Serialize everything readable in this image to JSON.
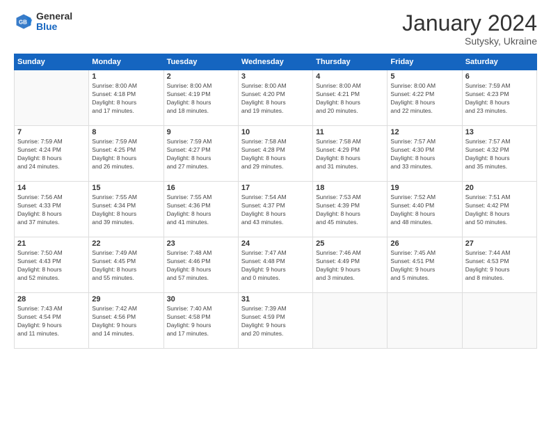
{
  "header": {
    "logo_general": "General",
    "logo_blue": "Blue",
    "month_title": "January 2024",
    "subtitle": "Sutysky, Ukraine"
  },
  "weekdays": [
    "Sunday",
    "Monday",
    "Tuesday",
    "Wednesday",
    "Thursday",
    "Friday",
    "Saturday"
  ],
  "weeks": [
    [
      {
        "day": "",
        "sunrise": "",
        "sunset": "",
        "daylight": ""
      },
      {
        "day": "1",
        "sunrise": "Sunrise: 8:00 AM",
        "sunset": "Sunset: 4:18 PM",
        "daylight": "Daylight: 8 hours and 17 minutes."
      },
      {
        "day": "2",
        "sunrise": "Sunrise: 8:00 AM",
        "sunset": "Sunset: 4:19 PM",
        "daylight": "Daylight: 8 hours and 18 minutes."
      },
      {
        "day": "3",
        "sunrise": "Sunrise: 8:00 AM",
        "sunset": "Sunset: 4:20 PM",
        "daylight": "Daylight: 8 hours and 19 minutes."
      },
      {
        "day": "4",
        "sunrise": "Sunrise: 8:00 AM",
        "sunset": "Sunset: 4:21 PM",
        "daylight": "Daylight: 8 hours and 20 minutes."
      },
      {
        "day": "5",
        "sunrise": "Sunrise: 8:00 AM",
        "sunset": "Sunset: 4:22 PM",
        "daylight": "Daylight: 8 hours and 22 minutes."
      },
      {
        "day": "6",
        "sunrise": "Sunrise: 7:59 AM",
        "sunset": "Sunset: 4:23 PM",
        "daylight": "Daylight: 8 hours and 23 minutes."
      }
    ],
    [
      {
        "day": "7",
        "sunrise": "Sunrise: 7:59 AM",
        "sunset": "Sunset: 4:24 PM",
        "daylight": "Daylight: 8 hours and 24 minutes."
      },
      {
        "day": "8",
        "sunrise": "Sunrise: 7:59 AM",
        "sunset": "Sunset: 4:25 PM",
        "daylight": "Daylight: 8 hours and 26 minutes."
      },
      {
        "day": "9",
        "sunrise": "Sunrise: 7:59 AM",
        "sunset": "Sunset: 4:27 PM",
        "daylight": "Daylight: 8 hours and 27 minutes."
      },
      {
        "day": "10",
        "sunrise": "Sunrise: 7:58 AM",
        "sunset": "Sunset: 4:28 PM",
        "daylight": "Daylight: 8 hours and 29 minutes."
      },
      {
        "day": "11",
        "sunrise": "Sunrise: 7:58 AM",
        "sunset": "Sunset: 4:29 PM",
        "daylight": "Daylight: 8 hours and 31 minutes."
      },
      {
        "day": "12",
        "sunrise": "Sunrise: 7:57 AM",
        "sunset": "Sunset: 4:30 PM",
        "daylight": "Daylight: 8 hours and 33 minutes."
      },
      {
        "day": "13",
        "sunrise": "Sunrise: 7:57 AM",
        "sunset": "Sunset: 4:32 PM",
        "daylight": "Daylight: 8 hours and 35 minutes."
      }
    ],
    [
      {
        "day": "14",
        "sunrise": "Sunrise: 7:56 AM",
        "sunset": "Sunset: 4:33 PM",
        "daylight": "Daylight: 8 hours and 37 minutes."
      },
      {
        "day": "15",
        "sunrise": "Sunrise: 7:55 AM",
        "sunset": "Sunset: 4:34 PM",
        "daylight": "Daylight: 8 hours and 39 minutes."
      },
      {
        "day": "16",
        "sunrise": "Sunrise: 7:55 AM",
        "sunset": "Sunset: 4:36 PM",
        "daylight": "Daylight: 8 hours and 41 minutes."
      },
      {
        "day": "17",
        "sunrise": "Sunrise: 7:54 AM",
        "sunset": "Sunset: 4:37 PM",
        "daylight": "Daylight: 8 hours and 43 minutes."
      },
      {
        "day": "18",
        "sunrise": "Sunrise: 7:53 AM",
        "sunset": "Sunset: 4:39 PM",
        "daylight": "Daylight: 8 hours and 45 minutes."
      },
      {
        "day": "19",
        "sunrise": "Sunrise: 7:52 AM",
        "sunset": "Sunset: 4:40 PM",
        "daylight": "Daylight: 8 hours and 48 minutes."
      },
      {
        "day": "20",
        "sunrise": "Sunrise: 7:51 AM",
        "sunset": "Sunset: 4:42 PM",
        "daylight": "Daylight: 8 hours and 50 minutes."
      }
    ],
    [
      {
        "day": "21",
        "sunrise": "Sunrise: 7:50 AM",
        "sunset": "Sunset: 4:43 PM",
        "daylight": "Daylight: 8 hours and 52 minutes."
      },
      {
        "day": "22",
        "sunrise": "Sunrise: 7:49 AM",
        "sunset": "Sunset: 4:45 PM",
        "daylight": "Daylight: 8 hours and 55 minutes."
      },
      {
        "day": "23",
        "sunrise": "Sunrise: 7:48 AM",
        "sunset": "Sunset: 4:46 PM",
        "daylight": "Daylight: 8 hours and 57 minutes."
      },
      {
        "day": "24",
        "sunrise": "Sunrise: 7:47 AM",
        "sunset": "Sunset: 4:48 PM",
        "daylight": "Daylight: 9 hours and 0 minutes."
      },
      {
        "day": "25",
        "sunrise": "Sunrise: 7:46 AM",
        "sunset": "Sunset: 4:49 PM",
        "daylight": "Daylight: 9 hours and 3 minutes."
      },
      {
        "day": "26",
        "sunrise": "Sunrise: 7:45 AM",
        "sunset": "Sunset: 4:51 PM",
        "daylight": "Daylight: 9 hours and 5 minutes."
      },
      {
        "day": "27",
        "sunrise": "Sunrise: 7:44 AM",
        "sunset": "Sunset: 4:53 PM",
        "daylight": "Daylight: 9 hours and 8 minutes."
      }
    ],
    [
      {
        "day": "28",
        "sunrise": "Sunrise: 7:43 AM",
        "sunset": "Sunset: 4:54 PM",
        "daylight": "Daylight: 9 hours and 11 minutes."
      },
      {
        "day": "29",
        "sunrise": "Sunrise: 7:42 AM",
        "sunset": "Sunset: 4:56 PM",
        "daylight": "Daylight: 9 hours and 14 minutes."
      },
      {
        "day": "30",
        "sunrise": "Sunrise: 7:40 AM",
        "sunset": "Sunset: 4:58 PM",
        "daylight": "Daylight: 9 hours and 17 minutes."
      },
      {
        "day": "31",
        "sunrise": "Sunrise: 7:39 AM",
        "sunset": "Sunset: 4:59 PM",
        "daylight": "Daylight: 9 hours and 20 minutes."
      },
      {
        "day": "",
        "sunrise": "",
        "sunset": "",
        "daylight": ""
      },
      {
        "day": "",
        "sunrise": "",
        "sunset": "",
        "daylight": ""
      },
      {
        "day": "",
        "sunrise": "",
        "sunset": "",
        "daylight": ""
      }
    ]
  ]
}
